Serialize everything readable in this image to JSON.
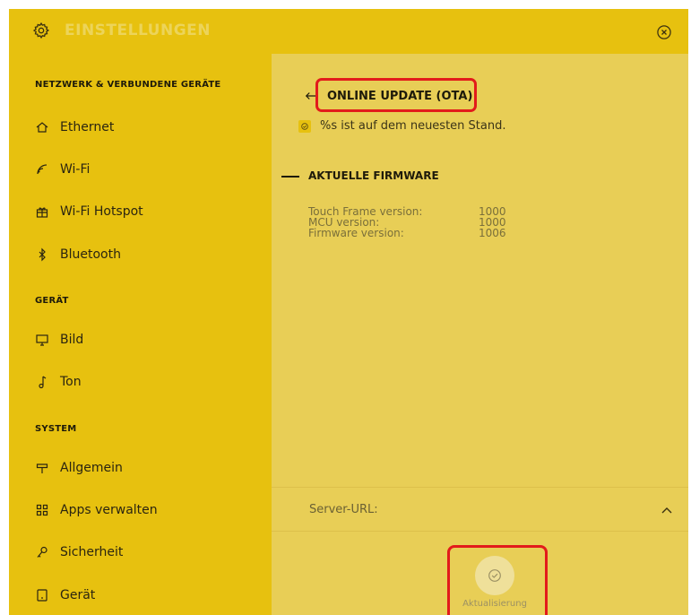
{
  "header": {
    "title": "EINSTELLUNGEN",
    "icons": {
      "settings": "gear-icon",
      "close": "close-circle-icon"
    }
  },
  "sidebar": {
    "sections": [
      {
        "title": "NETZWERK & VERBUNDENE GERÄTE",
        "items": [
          {
            "label": "Ethernet",
            "icon": "home-icon"
          },
          {
            "label": "Wi-Fi",
            "icon": "wifi-icon"
          },
          {
            "label": "Wi-Fi Hotspot",
            "icon": "gift-icon"
          },
          {
            "label": "Bluetooth",
            "icon": "bluetooth-icon"
          }
        ]
      },
      {
        "title": "GERÄT",
        "items": [
          {
            "label": "Bild",
            "icon": "monitor-icon"
          },
          {
            "label": "Ton",
            "icon": "music-note-icon"
          }
        ]
      },
      {
        "title": "SYSTEM",
        "items": [
          {
            "label": "Allgemein",
            "icon": "signpost-icon"
          },
          {
            "label": "Apps verwalten",
            "icon": "apps-grid-icon"
          },
          {
            "label": "Sicherheit",
            "icon": "key-icon"
          },
          {
            "label": "Gerät",
            "icon": "device-icon"
          }
        ]
      }
    ]
  },
  "main": {
    "title": "ONLINE UPDATE (OTA)",
    "status_text": "%s ist auf dem neuesten Stand.",
    "firmware_section_title": "AKTUELLE FIRMWARE",
    "firmware": [
      {
        "label": "Touch Frame version:",
        "value": "1000"
      },
      {
        "label": "MCU version:",
        "value": "1000"
      },
      {
        "label": "Firmware version:",
        "value": "1006"
      }
    ],
    "server_url_label": "Server-URL:",
    "update_button_label": "Aktualisierung"
  },
  "colors": {
    "header_bg": "#e7c10f",
    "sidebar_bg": "#e7c10f",
    "main_bg": "#e8ce56",
    "text_dark": "#1e1a0a",
    "highlight_red": "#e21b1b"
  }
}
